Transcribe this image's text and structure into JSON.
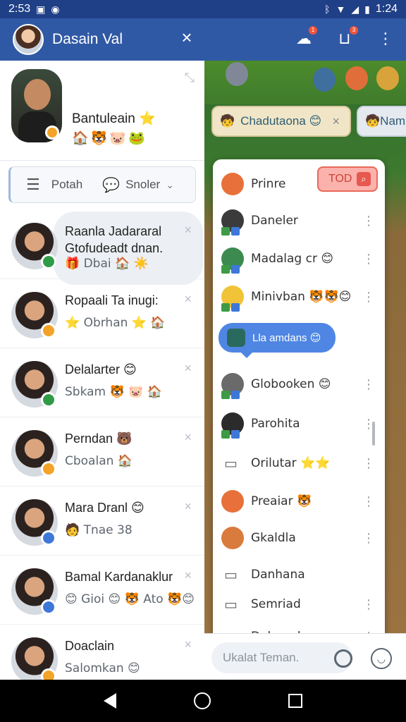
{
  "status_bar": {
    "time_left": "2:53",
    "time_right": "1:24",
    "icons": [
      "notification-icon",
      "circle-icon",
      "bluetooth-icon",
      "wifi-icon",
      "signal-icon",
      "battery-icon"
    ]
  },
  "app_bar": {
    "title": "Dasain Val",
    "close_label": "×",
    "notification_badge": "1",
    "inbox_badge": "3"
  },
  "profile": {
    "name": "Bantuleain ⭐",
    "emojis": "🏠🐯🐷🐸"
  },
  "search": {
    "left_label": "Potah",
    "right_label": "Snoler"
  },
  "contacts": [
    {
      "name": "Raanla Jadararal",
      "line2": "Gtofudeadt dnan.",
      "subtitle": "🎁 Dbai 🏠 ☀️",
      "status_color": "#2f9b47",
      "active": true
    },
    {
      "name": "Ropaali Ta inugi:",
      "subtitle": "⭐ Obrhan ⭐ 🏠",
      "status_color": "#f3a327",
      "active": false
    },
    {
      "name": "Delalarter 😊",
      "subtitle": "Sbkam 🐯 🐷 🏠",
      "status_color": "#2f9b47",
      "active": false
    },
    {
      "name": "Perndan 🐻",
      "subtitle": "Cboalan 🏠",
      "status_color": "#f3a327",
      "active": false
    },
    {
      "name": "Mara Dranl 😊",
      "subtitle": "🧑 Tnae 38",
      "status_color": "#3d78d8",
      "active": false
    },
    {
      "name": "Bamal Kardanaklur",
      "subtitle": "😊 Gioi 😊 🐯 Ato 🐯😊",
      "status_color": "#3d78d8",
      "active": false
    },
    {
      "name": "Doaclain",
      "subtitle": "Salomkan 😊",
      "status_color": "#f3a327",
      "active": false
    }
  ],
  "game": {
    "tab_active": "Chadutaona 😊",
    "tab_other": "Nam",
    "popup_items": [
      {
        "label": "Prinre",
        "color": "#e8703a",
        "badges": false
      },
      {
        "label": "Daneler",
        "color": "#3b3b3b",
        "badges": true
      },
      {
        "label": "Madalag cr 😊",
        "color": "#3c8a4f",
        "badges": true
      },
      {
        "label": "Minivban 🐯🐯😊",
        "color": "#f0c338",
        "badges": true
      },
      {
        "label": "Globooken 😊",
        "color": "#6a6a6a",
        "badges": true
      },
      {
        "label": "Parohita",
        "color": "#2b2b2b",
        "badges": true
      },
      {
        "label": "Orilutar ⭐⭐",
        "color": "",
        "badges": false
      },
      {
        "label": "Preaiar 🐯",
        "color": "#e8703a",
        "badges": false
      },
      {
        "label": "Gkaldla",
        "color": "#d97b3c",
        "badges": false
      },
      {
        "label": "Danhana",
        "color": "",
        "badges": false
      },
      {
        "label": "Semriad",
        "color": "",
        "badges": false
      },
      {
        "label": "Dabaoule",
        "color": "",
        "badges": false
      }
    ],
    "red_button": "TOD",
    "tooltip": "Lla amdans 😊"
  },
  "chat_input": {
    "placeholder": "Ukalat Teman."
  },
  "colors": {
    "app_bar": "#3059a5",
    "status_bar": "#1f3f86",
    "accent_green": "#1b9a49",
    "tooltip_blue": "#4f86e4"
  }
}
